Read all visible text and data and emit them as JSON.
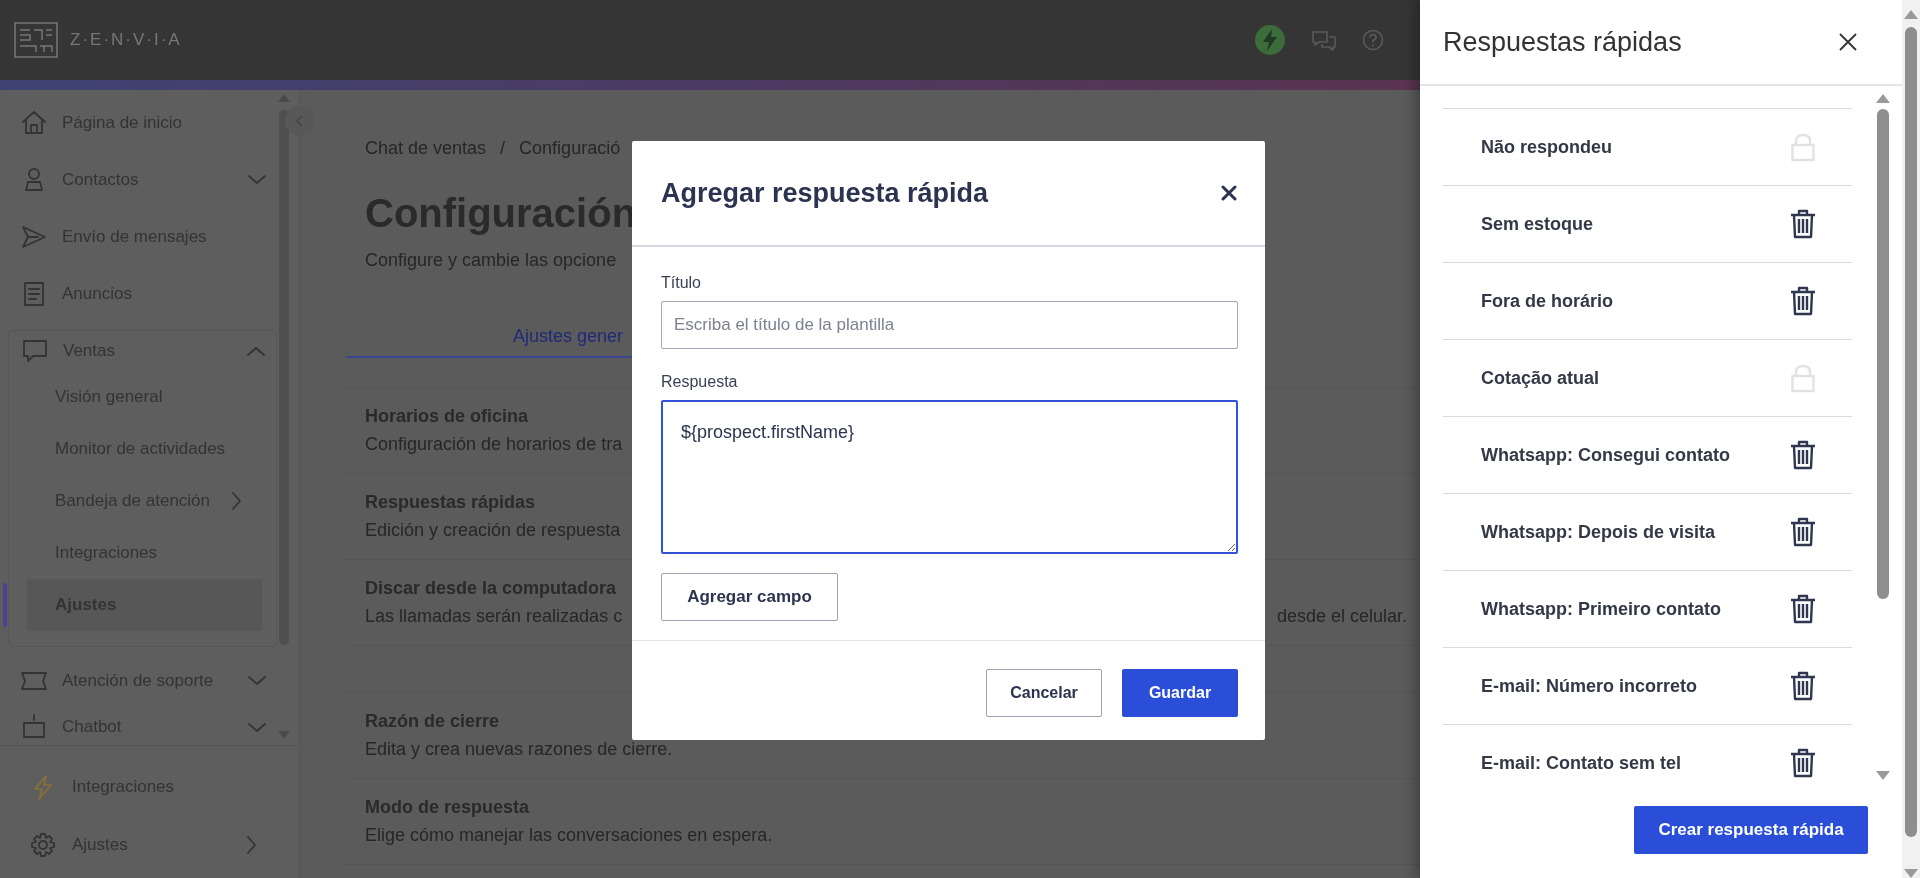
{
  "header": {
    "logo_text": "Z·E·N·V·I·A"
  },
  "sidebar": {
    "items": [
      {
        "label": "Página de inicio",
        "selected": false
      },
      {
        "label": "Contactos",
        "selected": false,
        "expanded": false
      },
      {
        "label": "Envío de mensajes",
        "selected": false
      },
      {
        "label": "Anuncios",
        "selected": false
      },
      {
        "label": "Ventas",
        "selected": false,
        "expanded": true,
        "children": [
          {
            "label": "Visión general",
            "selected": false
          },
          {
            "label": "Monitor de actividades",
            "selected": false
          },
          {
            "label": "Bandeja de atención",
            "selected": false,
            "submenu": true
          },
          {
            "label": "Integraciones",
            "selected": false
          },
          {
            "label": "Ajustes",
            "selected": true
          }
        ]
      },
      {
        "label": "Atención de soporte",
        "selected": false,
        "expanded": false
      },
      {
        "label": "Chatbot",
        "selected": false,
        "expanded": false
      }
    ],
    "bottom_items": [
      {
        "label": "Integraciones"
      },
      {
        "label": "Ajustes",
        "submenu": true
      }
    ]
  },
  "main": {
    "breadcrumb": {
      "items": [
        "Chat de ventas",
        "Configuració"
      ],
      "separator": "/"
    },
    "title": "Configuración",
    "subtitle": "Configure y cambie las opcione",
    "tabs": [
      {
        "label": "Ajustes gener",
        "selected": true
      }
    ],
    "groups": [
      [
        {
          "title": "Horarios de oficina",
          "description": "Configuración de horarios de tra"
        },
        {
          "title": "Respuestas rápidas",
          "description": "Edición y creación de respuesta"
        },
        {
          "title": "Discar desde la computadora",
          "description": "Las llamadas serán realizadas c",
          "description_right": "desde el celular."
        }
      ],
      [
        {
          "title": "Razón de cierre",
          "description": "Edita y crea nuevas razones de cierre."
        },
        {
          "title": "Modo de respuesta",
          "description": "Elige cómo manejar las conversaciones en espera."
        }
      ]
    ]
  },
  "modal": {
    "title": "Agregar respuesta rápida",
    "title_field": {
      "label": "Título",
      "placeholder": "Escriba el título de la plantilla"
    },
    "response_field": {
      "label": "Respuesta",
      "value": "${prospect.firstName}",
      "focused": true
    },
    "add_field_button": "Agregar campo",
    "cancel_button": "Cancelar",
    "save_button": "Guardar"
  },
  "panel": {
    "title": "Respuestas rápidas",
    "items": [
      {
        "label": "Não respondeu",
        "locked": true
      },
      {
        "label": "Sem estoque",
        "locked": false
      },
      {
        "label": "Fora de horário",
        "locked": false
      },
      {
        "label": "Cotação atual",
        "locked": true
      },
      {
        "label": "Whatsapp: Consegui contato",
        "locked": false
      },
      {
        "label": "Whatsapp: Depois de visita",
        "locked": false
      },
      {
        "label": "Whatsapp: Primeiro contato",
        "locked": false
      },
      {
        "label": "E-mail: Número incorreto",
        "locked": false
      },
      {
        "label": "E-mail: Contato sem tel",
        "locked": false
      }
    ],
    "create_button": "Crear respuesta rápida"
  }
}
